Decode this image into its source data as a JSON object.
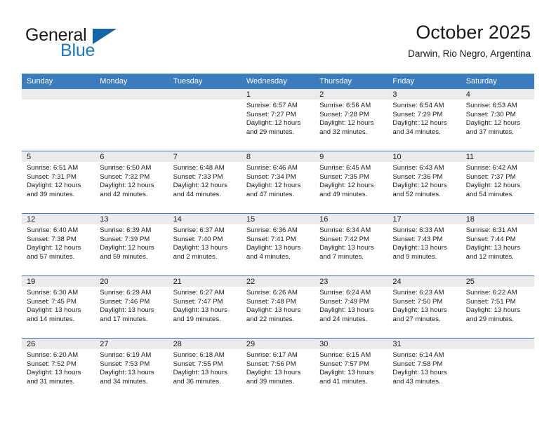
{
  "brand": {
    "word_one": "General",
    "word_two": "Blue",
    "colors": {
      "dark": "#1a1a1a",
      "blue": "#1c78c0",
      "triangle": "#1565a6"
    }
  },
  "header": {
    "title": "October 2025",
    "location": "Darwin, Rio Negro, Argentina"
  },
  "theme": {
    "header_blue": "#3a7cbe",
    "daynum_band": "#ebebeb",
    "text": "#1a1a1a"
  },
  "weekdays": [
    "Sunday",
    "Monday",
    "Tuesday",
    "Wednesday",
    "Thursday",
    "Friday",
    "Saturday"
  ],
  "weeks": [
    [
      {
        "day": "",
        "blank": true
      },
      {
        "day": "",
        "blank": true
      },
      {
        "day": "",
        "blank": true
      },
      {
        "day": "1",
        "sunrise": "Sunrise: 6:57 AM",
        "sunset": "Sunset: 7:27 PM",
        "daylight": "Daylight: 12 hours and 29 minutes."
      },
      {
        "day": "2",
        "sunrise": "Sunrise: 6:56 AM",
        "sunset": "Sunset: 7:28 PM",
        "daylight": "Daylight: 12 hours and 32 minutes."
      },
      {
        "day": "3",
        "sunrise": "Sunrise: 6:54 AM",
        "sunset": "Sunset: 7:29 PM",
        "daylight": "Daylight: 12 hours and 34 minutes."
      },
      {
        "day": "4",
        "sunrise": "Sunrise: 6:53 AM",
        "sunset": "Sunset: 7:30 PM",
        "daylight": "Daylight: 12 hours and 37 minutes."
      }
    ],
    [
      {
        "day": "5",
        "sunrise": "Sunrise: 6:51 AM",
        "sunset": "Sunset: 7:31 PM",
        "daylight": "Daylight: 12 hours and 39 minutes."
      },
      {
        "day": "6",
        "sunrise": "Sunrise: 6:50 AM",
        "sunset": "Sunset: 7:32 PM",
        "daylight": "Daylight: 12 hours and 42 minutes."
      },
      {
        "day": "7",
        "sunrise": "Sunrise: 6:48 AM",
        "sunset": "Sunset: 7:33 PM",
        "daylight": "Daylight: 12 hours and 44 minutes."
      },
      {
        "day": "8",
        "sunrise": "Sunrise: 6:46 AM",
        "sunset": "Sunset: 7:34 PM",
        "daylight": "Daylight: 12 hours and 47 minutes."
      },
      {
        "day": "9",
        "sunrise": "Sunrise: 6:45 AM",
        "sunset": "Sunset: 7:35 PM",
        "daylight": "Daylight: 12 hours and 49 minutes."
      },
      {
        "day": "10",
        "sunrise": "Sunrise: 6:43 AM",
        "sunset": "Sunset: 7:36 PM",
        "daylight": "Daylight: 12 hours and 52 minutes."
      },
      {
        "day": "11",
        "sunrise": "Sunrise: 6:42 AM",
        "sunset": "Sunset: 7:37 PM",
        "daylight": "Daylight: 12 hours and 54 minutes."
      }
    ],
    [
      {
        "day": "12",
        "sunrise": "Sunrise: 6:40 AM",
        "sunset": "Sunset: 7:38 PM",
        "daylight": "Daylight: 12 hours and 57 minutes."
      },
      {
        "day": "13",
        "sunrise": "Sunrise: 6:39 AM",
        "sunset": "Sunset: 7:39 PM",
        "daylight": "Daylight: 12 hours and 59 minutes."
      },
      {
        "day": "14",
        "sunrise": "Sunrise: 6:37 AM",
        "sunset": "Sunset: 7:40 PM",
        "daylight": "Daylight: 13 hours and 2 minutes."
      },
      {
        "day": "15",
        "sunrise": "Sunrise: 6:36 AM",
        "sunset": "Sunset: 7:41 PM",
        "daylight": "Daylight: 13 hours and 4 minutes."
      },
      {
        "day": "16",
        "sunrise": "Sunrise: 6:34 AM",
        "sunset": "Sunset: 7:42 PM",
        "daylight": "Daylight: 13 hours and 7 minutes."
      },
      {
        "day": "17",
        "sunrise": "Sunrise: 6:33 AM",
        "sunset": "Sunset: 7:43 PM",
        "daylight": "Daylight: 13 hours and 9 minutes."
      },
      {
        "day": "18",
        "sunrise": "Sunrise: 6:31 AM",
        "sunset": "Sunset: 7:44 PM",
        "daylight": "Daylight: 13 hours and 12 minutes."
      }
    ],
    [
      {
        "day": "19",
        "sunrise": "Sunrise: 6:30 AM",
        "sunset": "Sunset: 7:45 PM",
        "daylight": "Daylight: 13 hours and 14 minutes."
      },
      {
        "day": "20",
        "sunrise": "Sunrise: 6:29 AM",
        "sunset": "Sunset: 7:46 PM",
        "daylight": "Daylight: 13 hours and 17 minutes."
      },
      {
        "day": "21",
        "sunrise": "Sunrise: 6:27 AM",
        "sunset": "Sunset: 7:47 PM",
        "daylight": "Daylight: 13 hours and 19 minutes."
      },
      {
        "day": "22",
        "sunrise": "Sunrise: 6:26 AM",
        "sunset": "Sunset: 7:48 PM",
        "daylight": "Daylight: 13 hours and 22 minutes."
      },
      {
        "day": "23",
        "sunrise": "Sunrise: 6:24 AM",
        "sunset": "Sunset: 7:49 PM",
        "daylight": "Daylight: 13 hours and 24 minutes."
      },
      {
        "day": "24",
        "sunrise": "Sunrise: 6:23 AM",
        "sunset": "Sunset: 7:50 PM",
        "daylight": "Daylight: 13 hours and 27 minutes."
      },
      {
        "day": "25",
        "sunrise": "Sunrise: 6:22 AM",
        "sunset": "Sunset: 7:51 PM",
        "daylight": "Daylight: 13 hours and 29 minutes."
      }
    ],
    [
      {
        "day": "26",
        "sunrise": "Sunrise: 6:20 AM",
        "sunset": "Sunset: 7:52 PM",
        "daylight": "Daylight: 13 hours and 31 minutes."
      },
      {
        "day": "27",
        "sunrise": "Sunrise: 6:19 AM",
        "sunset": "Sunset: 7:53 PM",
        "daylight": "Daylight: 13 hours and 34 minutes."
      },
      {
        "day": "28",
        "sunrise": "Sunrise: 6:18 AM",
        "sunset": "Sunset: 7:55 PM",
        "daylight": "Daylight: 13 hours and 36 minutes."
      },
      {
        "day": "29",
        "sunrise": "Sunrise: 6:17 AM",
        "sunset": "Sunset: 7:56 PM",
        "daylight": "Daylight: 13 hours and 39 minutes."
      },
      {
        "day": "30",
        "sunrise": "Sunrise: 6:15 AM",
        "sunset": "Sunset: 7:57 PM",
        "daylight": "Daylight: 13 hours and 41 minutes."
      },
      {
        "day": "31",
        "sunrise": "Sunrise: 6:14 AM",
        "sunset": "Sunset: 7:58 PM",
        "daylight": "Daylight: 13 hours and 43 minutes."
      },
      {
        "day": "",
        "blank": true
      }
    ]
  ]
}
